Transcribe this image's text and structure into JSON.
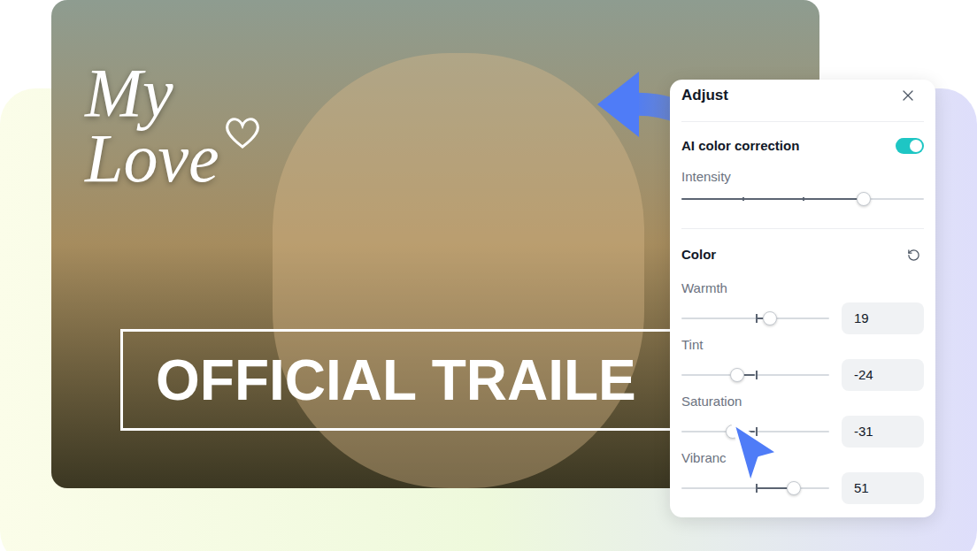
{
  "preview": {
    "titles": [
      {
        "text": "My Love",
        "kind": "script"
      },
      {
        "text": "OFFICIAL TRAILE",
        "kind": "boxed"
      }
    ]
  },
  "panel": {
    "title": "Adjust",
    "ai_correction": {
      "label": "AI color correction",
      "on": true,
      "intensity": {
        "label": "Intensity",
        "level": 0.75
      }
    },
    "color": {
      "title": "Color",
      "sliders": [
        {
          "label": "Warmth",
          "value": "19",
          "level": 0.6
        },
        {
          "label": "Tint",
          "value": "-24",
          "level": 0.38
        },
        {
          "label": "Saturation",
          "value": "-31",
          "level": 0.35
        },
        {
          "label": "Vibranc",
          "value": "51",
          "level": 0.76
        }
      ]
    }
  }
}
